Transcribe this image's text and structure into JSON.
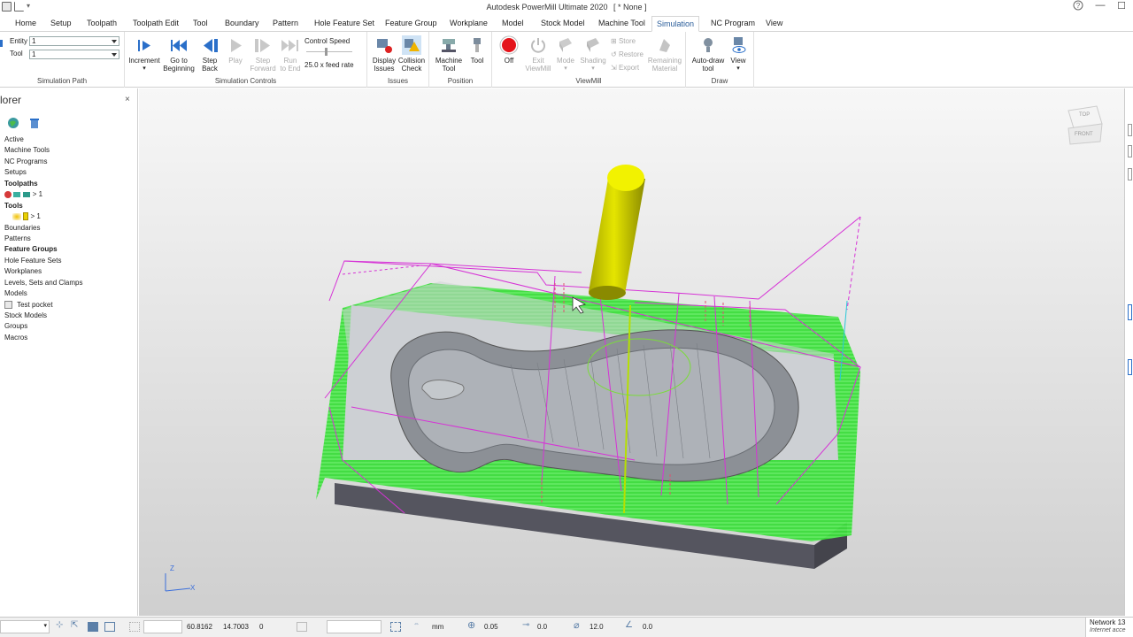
{
  "window": {
    "app_title": "Autodesk PowerMill Ultimate 2020",
    "doc_title": "[ * None ]",
    "help_icon": "help-icon",
    "minimize_label": "—",
    "maximize_label": "☐"
  },
  "tabs": [
    "Home",
    "Setup",
    "Toolpath",
    "Toolpath Edit",
    "Tool",
    "Boundary",
    "Pattern",
    "Hole Feature Set",
    "Feature Group",
    "Workplane",
    "Model",
    "Stock Model",
    "Machine Tool",
    "Simulation",
    "NC Program",
    "View"
  ],
  "active_tab": "Simulation",
  "ribbon": {
    "sim_path": {
      "group": "Simulation Path",
      "entity_label": "Entity",
      "entity_value": "1",
      "tool_label": "Tool",
      "tool_value": "1"
    },
    "sim_controls": {
      "group": "Simulation Controls",
      "increment": "Increment",
      "go_to_beginning_1": "Go to",
      "go_to_beginning_2": "Beginning",
      "step_back_1": "Step",
      "step_back_2": "Back",
      "play": "Play",
      "step_forward_1": "Step",
      "step_forward_2": "Forward",
      "run_to_end_1": "Run",
      "run_to_end_2": "to End",
      "control_speed": "Control Speed",
      "feed_rate": "25.0 x feed rate"
    },
    "issues": {
      "group": "Issues",
      "display_1": "Display",
      "display_2": "Issues",
      "collision_1": "Collision",
      "collision_2": "Check"
    },
    "position": {
      "group": "Position",
      "machine_1": "Machine",
      "machine_2": "Tool",
      "tool": "Tool"
    },
    "viewmill": {
      "group": "ViewMill",
      "off": "Off",
      "exit_1": "Exit",
      "exit_2": "ViewMill",
      "mode": "Mode",
      "shading": "Shading",
      "store": "Store",
      "restore": "Restore",
      "export": "Export",
      "remaining_1": "Remaining",
      "remaining_2": "Material"
    },
    "draw": {
      "group": "Draw",
      "autodraw_1": "Auto-draw",
      "autodraw_2": "tool",
      "view": "View"
    }
  },
  "explorer": {
    "title": "lorer",
    "close": "×",
    "items": [
      {
        "label": "Active",
        "bold": false
      },
      {
        "label": "Machine Tools",
        "bold": false
      },
      {
        "label": "NC Programs",
        "bold": false
      },
      {
        "label": "Setups",
        "bold": false
      },
      {
        "label": "Toolpaths",
        "bold": true
      },
      {
        "label": "> 1",
        "bold": false,
        "sub": "toolpath"
      },
      {
        "label": "Tools",
        "bold": true
      },
      {
        "label": "> 1",
        "bold": false,
        "sub": "tool"
      },
      {
        "label": "Boundaries",
        "bold": false
      },
      {
        "label": "Patterns",
        "bold": false
      },
      {
        "label": "Feature Groups",
        "bold": true
      },
      {
        "label": "Hole Feature Sets",
        "bold": false
      },
      {
        "label": "Workplanes",
        "bold": false
      },
      {
        "label": "Levels, Sets and Clamps",
        "bold": false
      },
      {
        "label": "Models",
        "bold": false
      },
      {
        "label": "Test pocket",
        "bold": false,
        "sub": "model"
      },
      {
        "label": "Stock Models",
        "bold": false
      },
      {
        "label": "Groups",
        "bold": false
      },
      {
        "label": "Macros",
        "bold": false
      }
    ]
  },
  "viewcube": {
    "top": "TOP",
    "front": "FRONT"
  },
  "triad": {
    "z": "Z",
    "x": "X"
  },
  "status": {
    "x": "60.8162",
    "y": "14.7003",
    "z": "0",
    "units": "mm",
    "tolerance": "0.05",
    "thickness": "0.0",
    "diameter": "12.0",
    "angle": "0.0",
    "network_1": "Network 13",
    "network_2": "Internet acce"
  },
  "colors": {
    "toolpath_green": "#3ef03e",
    "link_magenta": "#d633d6",
    "tool_yellow": "#d8d800",
    "stock_gray": "#55555f",
    "accent_blue": "#2a6fc9"
  }
}
